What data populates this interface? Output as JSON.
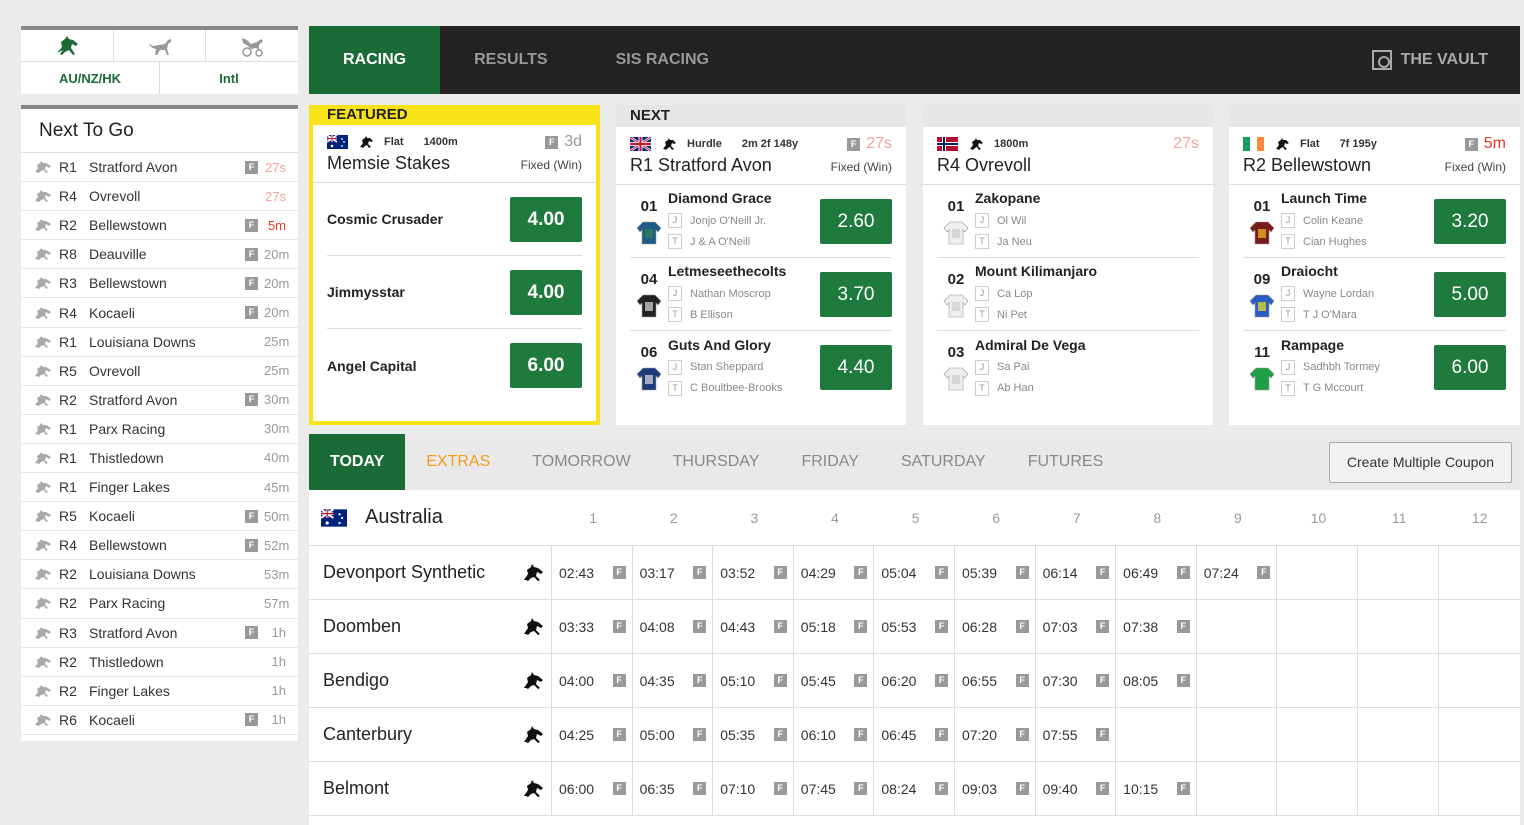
{
  "sidebar": {
    "regions": [
      "AU/NZ/HK",
      "Intl"
    ],
    "next_to_go_title": "Next To Go",
    "races": [
      {
        "race": "R1",
        "venue": "Stratford Avon",
        "fixed": true,
        "time": "27s",
        "style": "hot"
      },
      {
        "race": "R4",
        "venue": "Ovrevoll",
        "fixed": false,
        "time": "27s",
        "style": "hot"
      },
      {
        "race": "R2",
        "venue": "Bellewstown",
        "fixed": true,
        "time": "5m",
        "style": "red"
      },
      {
        "race": "R8",
        "venue": "Deauville",
        "fixed": true,
        "time": "20m",
        "style": ""
      },
      {
        "race": "R3",
        "venue": "Bellewstown",
        "fixed": true,
        "time": "20m",
        "style": ""
      },
      {
        "race": "R4",
        "venue": "Kocaeli",
        "fixed": true,
        "time": "20m",
        "style": ""
      },
      {
        "race": "R1",
        "venue": "Louisiana Downs",
        "fixed": false,
        "time": "25m",
        "style": ""
      },
      {
        "race": "R5",
        "venue": "Ovrevoll",
        "fixed": false,
        "time": "25m",
        "style": ""
      },
      {
        "race": "R2",
        "venue": "Stratford Avon",
        "fixed": true,
        "time": "30m",
        "style": ""
      },
      {
        "race": "R1",
        "venue": "Parx Racing",
        "fixed": false,
        "time": "30m",
        "style": ""
      },
      {
        "race": "R1",
        "venue": "Thistledown",
        "fixed": false,
        "time": "40m",
        "style": ""
      },
      {
        "race": "R1",
        "venue": "Finger Lakes",
        "fixed": false,
        "time": "45m",
        "style": ""
      },
      {
        "race": "R5",
        "venue": "Kocaeli",
        "fixed": true,
        "time": "50m",
        "style": ""
      },
      {
        "race": "R4",
        "venue": "Bellewstown",
        "fixed": true,
        "time": "52m",
        "style": ""
      },
      {
        "race": "R2",
        "venue": "Louisiana Downs",
        "fixed": false,
        "time": "53m",
        "style": ""
      },
      {
        "race": "R2",
        "venue": "Parx Racing",
        "fixed": false,
        "time": "57m",
        "style": ""
      },
      {
        "race": "R3",
        "venue": "Stratford Avon",
        "fixed": true,
        "time": "1h",
        "style": ""
      },
      {
        "race": "R2",
        "venue": "Thistledown",
        "fixed": false,
        "time": "1h",
        "style": ""
      },
      {
        "race": "R2",
        "venue": "Finger Lakes",
        "fixed": false,
        "time": "1h",
        "style": ""
      },
      {
        "race": "R6",
        "venue": "Kocaeli",
        "fixed": true,
        "time": "1h",
        "style": ""
      }
    ]
  },
  "nav": {
    "items": [
      "RACING",
      "RESULTS",
      "SIS RACING"
    ],
    "vault": "THE VAULT"
  },
  "featured": {
    "label": "FEATURED",
    "type": "Flat",
    "distance": "1400m",
    "time": "3d",
    "title": "Memsie Stakes",
    "bet_type": "Fixed (Win)",
    "runners": [
      {
        "name": "Cosmic Crusader",
        "odds": "4.00"
      },
      {
        "name": "Jimmysstar",
        "odds": "4.00"
      },
      {
        "name": "Angel Capital",
        "odds": "6.00"
      }
    ]
  },
  "next_label": "NEXT",
  "next_races": [
    {
      "flag": "uk",
      "type": "Hurdle",
      "distance": "2m 2f 148y",
      "time": "27s",
      "time_style": "hot",
      "fixed": true,
      "title": "R1 Stratford Avon",
      "bet_type": "Fixed (Win)",
      "runners": [
        {
          "num": "01",
          "name": "Diamond Grace",
          "jockey": "Jonjo O'Neill Jr.",
          "trainer": "J & A O'Neill",
          "odds": "2.60"
        },
        {
          "num": "04",
          "name": "Letmeseethecolts",
          "jockey": "Nathan Moscrop",
          "trainer": "B Ellison",
          "odds": "3.70"
        },
        {
          "num": "06",
          "name": "Guts And Glory",
          "jockey": "Stan Sheppard",
          "trainer": "C Boultbee-Brooks",
          "odds": "4.40"
        }
      ]
    },
    {
      "flag": "no",
      "type": "",
      "distance": "1800m",
      "time": "27s",
      "time_style": "hot",
      "fixed": false,
      "title": "R4 Ovrevoll",
      "bet_type": "",
      "runners": [
        {
          "num": "01",
          "name": "Zakopane",
          "jockey": "Ol Wil",
          "trainer": "Ja Neu",
          "odds": ""
        },
        {
          "num": "02",
          "name": "Mount Kilimanjaro",
          "jockey": "Ca Lop",
          "trainer": "Ni Pet",
          "odds": ""
        },
        {
          "num": "03",
          "name": "Admiral De Vega",
          "jockey": "Sa Pai",
          "trainer": "Ab Han",
          "odds": ""
        }
      ]
    },
    {
      "flag": "ie",
      "type": "Flat",
      "distance": "7f 195y",
      "time": "5m",
      "time_style": "red",
      "fixed": true,
      "title": "R2 Bellewstown",
      "bet_type": "Fixed (Win)",
      "runners": [
        {
          "num": "01",
          "name": "Launch Time",
          "jockey": "Colin Keane",
          "trainer": "Cian Hughes",
          "odds": "3.20"
        },
        {
          "num": "09",
          "name": "Draiocht",
          "jockey": "Wayne Lordan",
          "trainer": "T J O'Mara",
          "odds": "5.00"
        },
        {
          "num": "11",
          "name": "Rampage",
          "jockey": "Sadhbh Tormey",
          "trainer": "T G Mccourt",
          "odds": "6.00"
        }
      ]
    }
  ],
  "day_tabs": [
    "TODAY",
    "EXTRAS",
    "TOMORROW",
    "THURSDAY",
    "FRIDAY",
    "SATURDAY",
    "FUTURES"
  ],
  "coupon_button": "Create Multiple Coupon",
  "country": "Australia",
  "race_columns": [
    "1",
    "2",
    "3",
    "4",
    "5",
    "6",
    "7",
    "8",
    "9",
    "10",
    "11",
    "12"
  ],
  "meetings": [
    {
      "name": "Devonport Synthetic",
      "times": [
        "02:43",
        "03:17",
        "03:52",
        "04:29",
        "05:04",
        "05:39",
        "06:14",
        "06:49",
        "07:24"
      ]
    },
    {
      "name": "Doomben",
      "times": [
        "03:33",
        "04:08",
        "04:43",
        "05:18",
        "05:53",
        "06:28",
        "07:03",
        "07:38"
      ]
    },
    {
      "name": "Bendigo",
      "times": [
        "04:00",
        "04:35",
        "05:10",
        "05:45",
        "06:20",
        "06:55",
        "07:30",
        "08:05"
      ]
    },
    {
      "name": "Canterbury",
      "times": [
        "04:25",
        "05:00",
        "05:35",
        "06:10",
        "06:45",
        "07:20",
        "07:55"
      ]
    },
    {
      "name": "Belmont",
      "times": [
        "06:00",
        "06:35",
        "07:10",
        "07:45",
        "08:24",
        "09:03",
        "09:40",
        "10:15"
      ]
    }
  ],
  "colors": {
    "brand_green": "#1b6b36",
    "odds_green": "#1e7a3d",
    "featured_yellow": "#f7e318",
    "extras_orange": "#f59a1a",
    "imminent": "#f3a39a",
    "urgent": "#e03b2a"
  }
}
